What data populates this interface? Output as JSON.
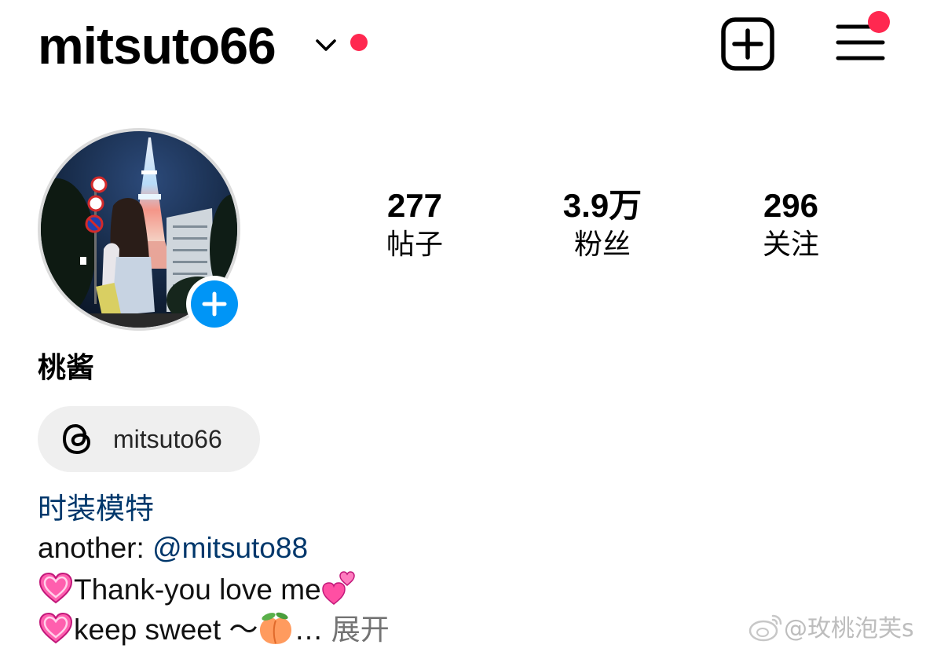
{
  "header": {
    "username": "mitsuto66",
    "icons": {
      "switch_account": "chevron-down-icon",
      "create": "plus-square-icon",
      "menu": "hamburger-menu-icon"
    },
    "notification_color": "#ff2850"
  },
  "profile": {
    "display_name": "桃酱",
    "add_story_icon": "plus-icon",
    "accent_color": "#0095f6"
  },
  "stats": [
    {
      "value": "277",
      "label": "帖子"
    },
    {
      "value": "3.9万",
      "label": "粉丝"
    },
    {
      "value": "296",
      "label": "关注"
    }
  ],
  "threads": {
    "icon": "threads-icon",
    "handle": "mitsuto66"
  },
  "bio": {
    "category": "时装模特",
    "line1_prefix": "another: ",
    "line1_mention": "@mitsuto88",
    "line2_text": "Thank-you love me",
    "line3_text": "keep sweet ～",
    "line3_ellipsis": "…",
    "more_label": "展开",
    "link_color": "#00376b"
  },
  "watermark": {
    "text": "@玫桃泡芙s",
    "icon": "weibo-icon"
  }
}
